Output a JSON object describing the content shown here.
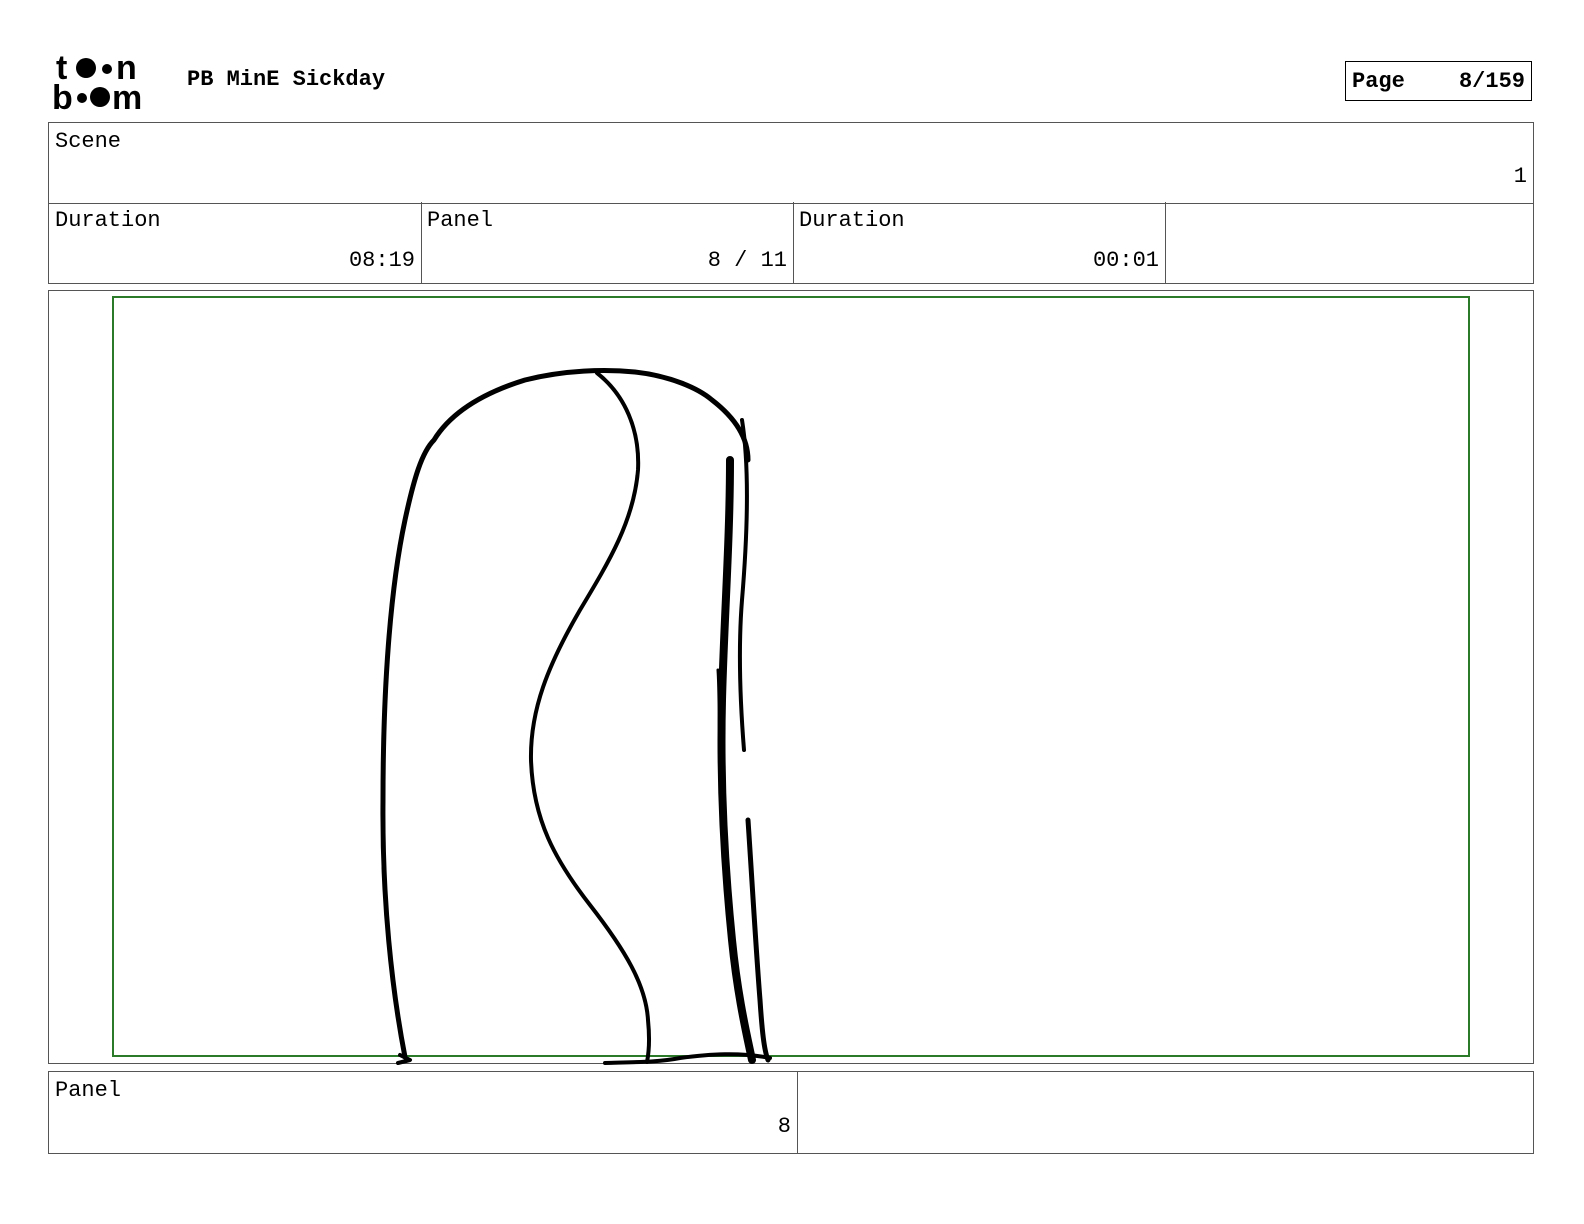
{
  "header": {
    "logo_text_top": "toon",
    "logo_text_bottom": "boom",
    "project_title": "PB MinE Sickday",
    "page_label": "Page",
    "page_value": "8/159"
  },
  "scene": {
    "label": "Scene",
    "value": "1"
  },
  "info_row": {
    "duration_label": "Duration",
    "duration_value": "08:19",
    "panel_label": "Panel",
    "panel_value": "8 / 11",
    "panel_duration_label": "Duration",
    "panel_duration_value": "00:01"
  },
  "footer": {
    "panel_label": "Panel",
    "panel_value": "8"
  },
  "colors": {
    "safe_frame": "#2a7a2a",
    "ink": "#000000",
    "border": "#555555"
  }
}
